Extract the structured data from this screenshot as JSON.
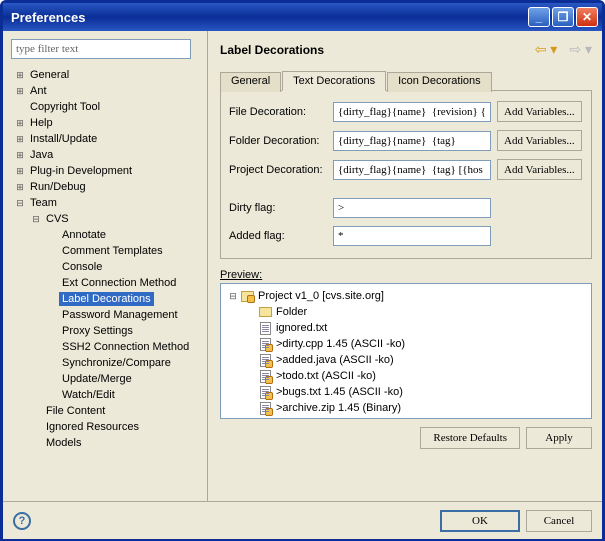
{
  "window": {
    "title": "Preferences"
  },
  "sidebar": {
    "filter_placeholder": "type filter text",
    "items": [
      {
        "label": "General",
        "depth": 0,
        "expand": "+"
      },
      {
        "label": "Ant",
        "depth": 0,
        "expand": "+"
      },
      {
        "label": "Copyright Tool",
        "depth": 0,
        "expand": ""
      },
      {
        "label": "Help",
        "depth": 0,
        "expand": "+"
      },
      {
        "label": "Install/Update",
        "depth": 0,
        "expand": "+"
      },
      {
        "label": "Java",
        "depth": 0,
        "expand": "+"
      },
      {
        "label": "Plug-in Development",
        "depth": 0,
        "expand": "+"
      },
      {
        "label": "Run/Debug",
        "depth": 0,
        "expand": "+"
      },
      {
        "label": "Team",
        "depth": 0,
        "expand": "-"
      },
      {
        "label": "CVS",
        "depth": 1,
        "expand": "-"
      },
      {
        "label": "Annotate",
        "depth": 2,
        "expand": ""
      },
      {
        "label": "Comment Templates",
        "depth": 2,
        "expand": ""
      },
      {
        "label": "Console",
        "depth": 2,
        "expand": ""
      },
      {
        "label": "Ext Connection Method",
        "depth": 2,
        "expand": ""
      },
      {
        "label": "Label Decorations",
        "depth": 2,
        "expand": "",
        "selected": true
      },
      {
        "label": "Password Management",
        "depth": 2,
        "expand": ""
      },
      {
        "label": "Proxy Settings",
        "depth": 2,
        "expand": ""
      },
      {
        "label": "SSH2 Connection Method",
        "depth": 2,
        "expand": ""
      },
      {
        "label": "Synchronize/Compare",
        "depth": 2,
        "expand": ""
      },
      {
        "label": "Update/Merge",
        "depth": 2,
        "expand": ""
      },
      {
        "label": "Watch/Edit",
        "depth": 2,
        "expand": ""
      },
      {
        "label": "File Content",
        "depth": 1,
        "expand": ""
      },
      {
        "label": "Ignored Resources",
        "depth": 1,
        "expand": ""
      },
      {
        "label": "Models",
        "depth": 1,
        "expand": ""
      }
    ]
  },
  "main": {
    "title": "Label Decorations",
    "tabs": {
      "general": "General",
      "text": "Text Decorations",
      "icon": "Icon Decorations",
      "active": "text"
    },
    "form": {
      "file_label": "File Decoration:",
      "file_value": "{dirty_flag}{name}  {revision} {",
      "folder_label": "Folder Decoration:",
      "folder_value": "{dirty_flag}{name}  {tag}",
      "project_label": "Project Decoration:",
      "project_value": "{dirty_flag}{name}  {tag} [{hos",
      "addvar": "Add Variables...",
      "dirty_label": "Dirty flag:",
      "dirty_value": ">",
      "added_label": "Added flag:",
      "added_value": "*"
    },
    "preview": {
      "label": "Preview:",
      "rows": [
        {
          "depth": 0,
          "tw": "-",
          "icon": "proj",
          "text": "Project  v1_0 [cvs.site.org]"
        },
        {
          "depth": 1,
          "tw": "",
          "icon": "folder",
          "text": "Folder"
        },
        {
          "depth": 1,
          "tw": "",
          "icon": "file",
          "text": "ignored.txt"
        },
        {
          "depth": 1,
          "tw": "",
          "icon": "filecvs",
          "text": ">dirty.cpp  1.45  (ASCII -ko)"
        },
        {
          "depth": 1,
          "tw": "",
          "icon": "filecvs",
          "text": ">added.java    (ASCII -ko)"
        },
        {
          "depth": 1,
          "tw": "",
          "icon": "filecvs",
          "text": ">todo.txt    (ASCII -ko)"
        },
        {
          "depth": 1,
          "tw": "",
          "icon": "filecvs",
          "text": ">bugs.txt  1.45  (ASCII -ko)"
        },
        {
          "depth": 1,
          "tw": "",
          "icon": "filecvs",
          "text": ">archive.zip  1.45  (Binary)"
        }
      ]
    },
    "buttons": {
      "restore": "Restore Defaults",
      "apply": "Apply"
    }
  },
  "footer": {
    "ok": "OK",
    "cancel": "Cancel"
  }
}
